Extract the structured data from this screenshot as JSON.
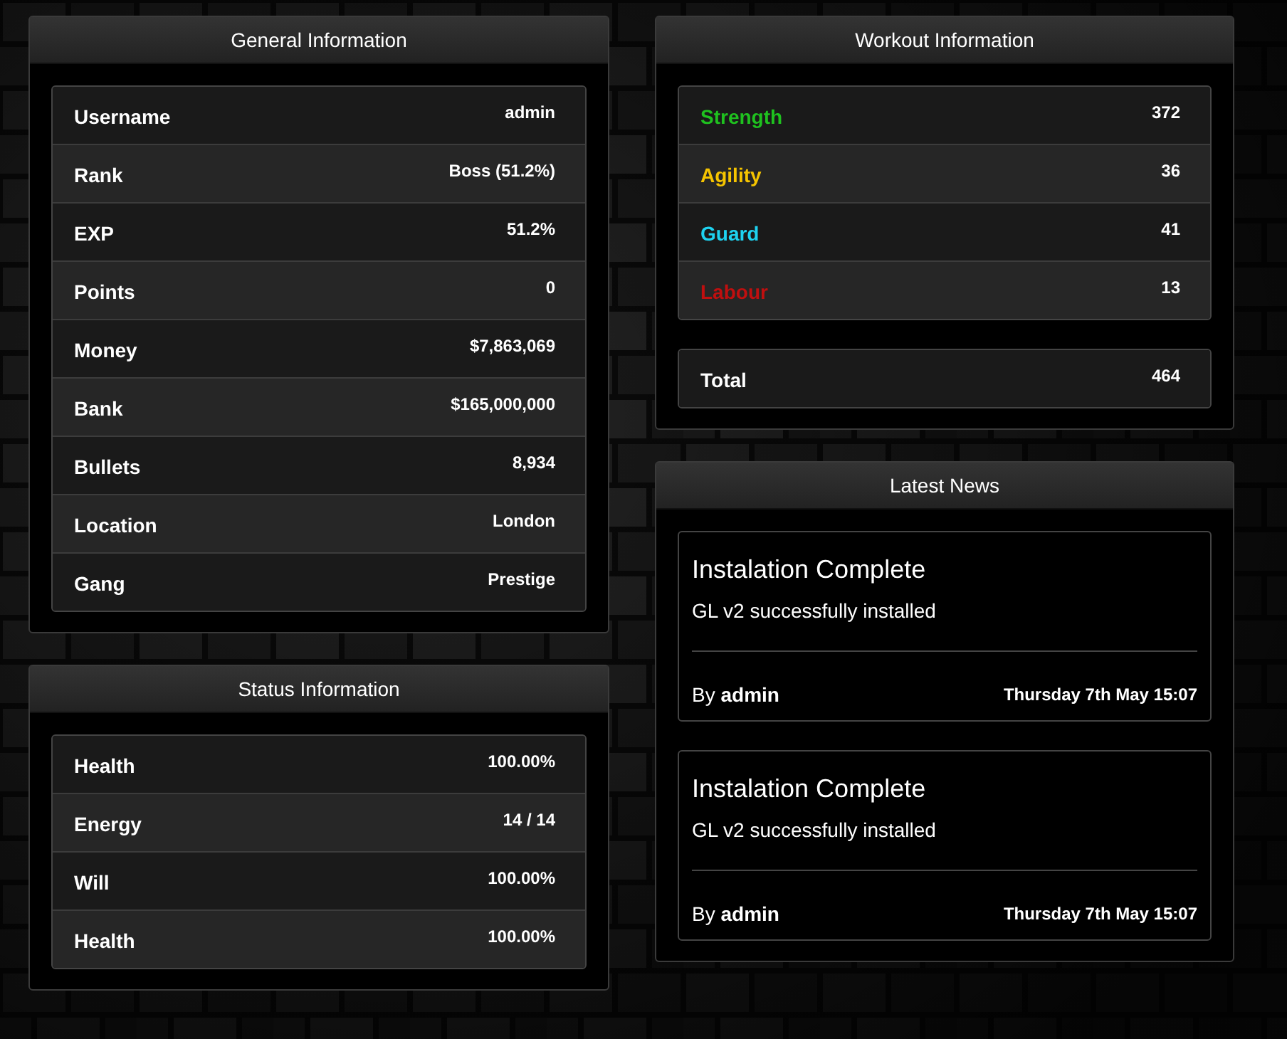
{
  "general": {
    "title": "General Information",
    "rows": [
      {
        "label": "Username",
        "value": "admin"
      },
      {
        "label": "Rank",
        "value": "Boss (51.2%)"
      },
      {
        "label": "EXP",
        "value": "51.2%"
      },
      {
        "label": "Points",
        "value": "0"
      },
      {
        "label": "Money",
        "value": "$7,863,069"
      },
      {
        "label": "Bank",
        "value": "$165,000,000"
      },
      {
        "label": "Bullets",
        "value": "8,934"
      },
      {
        "label": "Location",
        "value": "London"
      },
      {
        "label": "Gang",
        "value": "Prestige"
      }
    ]
  },
  "status": {
    "title": "Status Information",
    "rows": [
      {
        "label": "Health",
        "value": "100.00%"
      },
      {
        "label": "Energy",
        "value": "14 / 14"
      },
      {
        "label": "Will",
        "value": "100.00%"
      },
      {
        "label": "Health",
        "value": "100.00%"
      }
    ]
  },
  "workout": {
    "title": "Workout Information",
    "rows": [
      {
        "label": "Strength",
        "value": "372",
        "color": "#1fc11f"
      },
      {
        "label": "Agility",
        "value": "36",
        "color": "#f5c400"
      },
      {
        "label": "Guard",
        "value": "41",
        "color": "#1ed2f0"
      },
      {
        "label": "Labour",
        "value": "13",
        "color": "#c00f0f"
      }
    ],
    "total": {
      "label": "Total",
      "value": "464"
    }
  },
  "news": {
    "title": "Latest News",
    "items": [
      {
        "headline": "Instalation Complete",
        "body": "GL v2 successfully installed",
        "byline": "By **admin**",
        "date": "Thursday 7th May 15:07"
      },
      {
        "headline": "Instalation Complete",
        "body": "GL v2 successfully installed",
        "byline": "By **admin**",
        "date": "Thursday 7th May 15:07"
      }
    ]
  }
}
